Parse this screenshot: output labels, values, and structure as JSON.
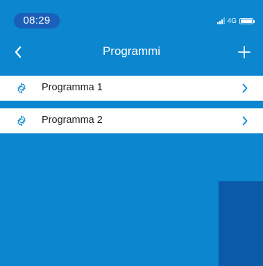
{
  "status_bar": {
    "time": "08:29",
    "network": "4G"
  },
  "nav": {
    "title": "Programmi"
  },
  "programs": [
    {
      "label": "Programma 1"
    },
    {
      "label": "Programma 2"
    }
  ],
  "colors": {
    "background": "#0b86cf",
    "pill": "#1b5fb8",
    "panel": "#0a5aa8",
    "row": "#ffffff"
  },
  "icons": {
    "back": "chevron-left-icon",
    "add": "plus-icon",
    "item": "gear-icon",
    "disclosure": "chevron-right-icon"
  }
}
